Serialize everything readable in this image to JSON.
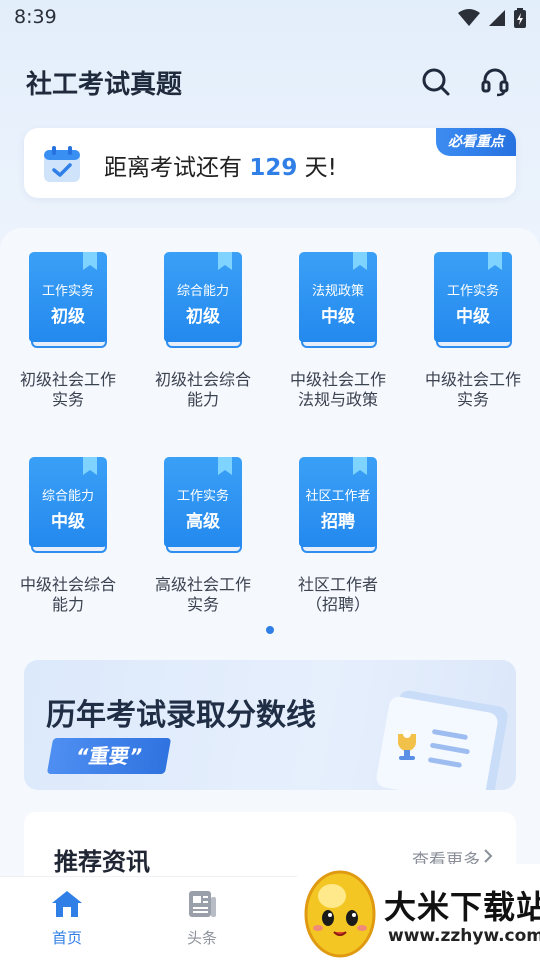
{
  "status_bar": {
    "time": "8:39"
  },
  "header": {
    "title": "社工考试真题",
    "search_icon": "search-icon",
    "service_icon": "headset-icon"
  },
  "countdown": {
    "prefix": "距离考试还有",
    "days": "129",
    "suffix": "天!",
    "badge": "必看重点"
  },
  "books": [
    {
      "line1": "工作实务",
      "line2": "初级",
      "caption": "初级社会工作实务"
    },
    {
      "line1": "综合能力",
      "line2": "初级",
      "caption": "初级社会综合能力"
    },
    {
      "line1": "法规政策",
      "line2": "中级",
      "caption": "中级社会工作法规与政策"
    },
    {
      "line1": "工作实务",
      "line2": "中级",
      "caption": "中级社会工作实务"
    },
    {
      "line1": "综合能力",
      "line2": "中级",
      "caption": "中级社会综合能力"
    },
    {
      "line1": "工作实务",
      "line2": "高级",
      "caption": "高级社会工作实务"
    },
    {
      "line1": "社区工作者",
      "line2": "招聘",
      "caption": "社区工作者（招聘）"
    }
  ],
  "score_banner": {
    "title": "历年考试录取分数线",
    "tag": "“重要”"
  },
  "news": {
    "title": "推荐资讯",
    "more": "查看更多"
  },
  "bottom_nav": {
    "home": "首页",
    "news": "头条"
  },
  "watermark": {
    "text": "大米下载站",
    "url": "www.zzhyw.com"
  },
  "colors": {
    "accent": "#2f7fe6",
    "book_blue": "#2489ee"
  }
}
